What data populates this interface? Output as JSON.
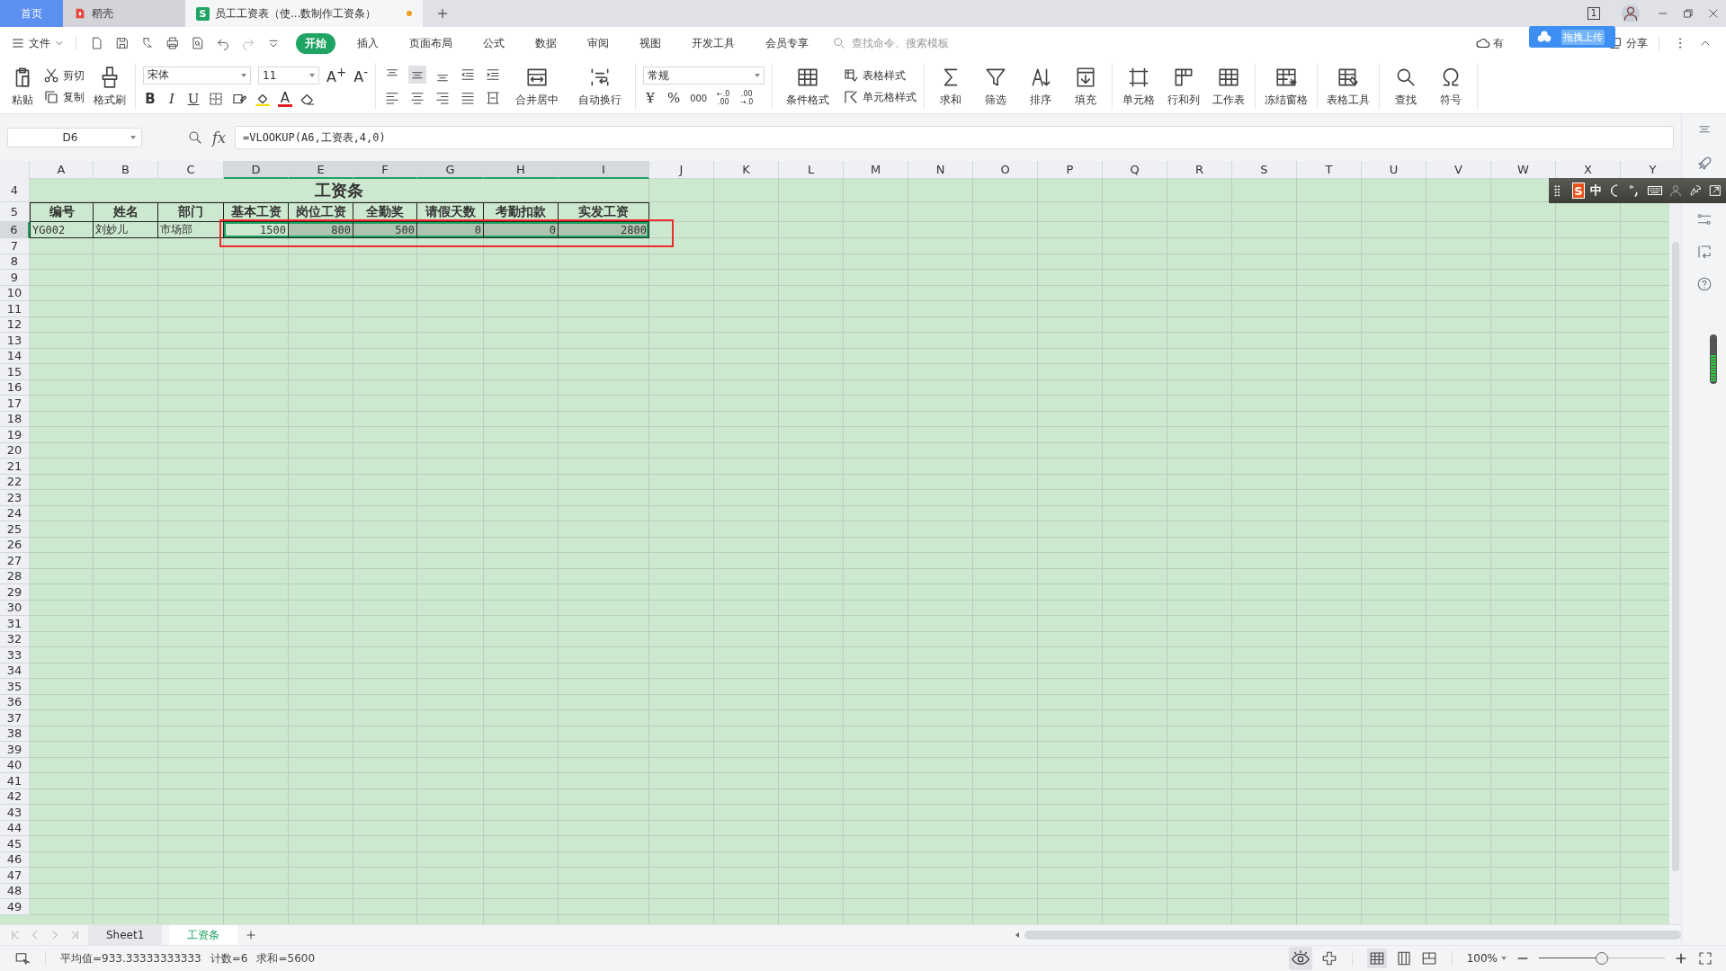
{
  "title_tabs": [
    {
      "label": "首页",
      "kind": "home",
      "selected": false
    },
    {
      "label": "稻壳",
      "kind": "docer",
      "selected": false
    },
    {
      "label": "员工工资表（使...数制作工资条）",
      "kind": "sheet",
      "selected": true,
      "modified": true,
      "logo": "S"
    }
  ],
  "window_badge": "1",
  "menu": {
    "file": "文件",
    "tabs": [
      {
        "label": "开始",
        "selected": true
      },
      {
        "label": "插入",
        "selected": false
      },
      {
        "label": "页面布局",
        "selected": false
      },
      {
        "label": "公式",
        "selected": false
      },
      {
        "label": "数据",
        "selected": false
      },
      {
        "label": "审阅",
        "selected": false
      },
      {
        "label": "视图",
        "selected": false
      },
      {
        "label": "开发工具",
        "selected": false
      },
      {
        "label": "会员专享",
        "selected": false
      }
    ],
    "search_placeholder": "查找命令、搜索模板",
    "sync_text": "有",
    "upload_tip": "拖拽上传",
    "share": "分享"
  },
  "ribbon": {
    "paste": "粘贴",
    "cut": "剪切",
    "copy": "复制",
    "format_painter": "格式刷",
    "font_name": "宋体",
    "font_size": "11",
    "grow_font": "A$^{+}$",
    "shrink_font": "A$^{-}$",
    "bold": "B",
    "italic": "I",
    "underline": "U",
    "font_color": "A",
    "merge_center": "合并居中",
    "wrap_text": "自动换行",
    "number_format": "常规",
    "currency": "¥",
    "percent": "%",
    "thousands": "000",
    "increase_decimal": [
      "←.0",
      ".00"
    ],
    "decrease_decimal": [
      ".00",
      "→.0"
    ],
    "conditional_format": "条件格式",
    "table_style": "表格样式",
    "cell_style": "单元格样式",
    "tools": [
      {
        "label": "求和"
      },
      {
        "label": "筛选"
      },
      {
        "label": "排序"
      },
      {
        "label": "填充"
      },
      {
        "label": "单元格"
      },
      {
        "label": "行和列"
      },
      {
        "label": "工作表"
      },
      {
        "label": "冻结窗格"
      },
      {
        "label": "表格工具"
      },
      {
        "label": "查找"
      },
      {
        "label": "符号"
      }
    ]
  },
  "formula_bar": {
    "cell_ref": "D6",
    "fx": "fx",
    "formula": "=VLOOKUP(A6,工资表,4,0)"
  },
  "columns": [
    {
      "label": "A",
      "selected": false
    },
    {
      "label": "B",
      "selected": false
    },
    {
      "label": "C",
      "selected": false
    },
    {
      "label": "D",
      "selected": true
    },
    {
      "label": "E",
      "selected": true
    },
    {
      "label": "F",
      "selected": true
    },
    {
      "label": "G",
      "selected": true
    },
    {
      "label": "H",
      "selected": true
    },
    {
      "label": "I",
      "selected": true
    },
    {
      "label": "J",
      "selected": false
    },
    {
      "label": "K",
      "selected": false
    },
    {
      "label": "L",
      "selected": false
    },
    {
      "label": "M",
      "selected": false
    },
    {
      "label": "N",
      "selected": false
    },
    {
      "label": "O",
      "selected": false
    },
    {
      "label": "P",
      "selected": false
    },
    {
      "label": "Q",
      "selected": false
    },
    {
      "label": "R",
      "selected": false
    },
    {
      "label": "S",
      "selected": false
    },
    {
      "label": "T",
      "selected": false
    },
    {
      "label": "U",
      "selected": false
    },
    {
      "label": "V",
      "selected": false
    },
    {
      "label": "W",
      "selected": false
    },
    {
      "label": "X",
      "selected": false
    },
    {
      "label": "Y",
      "selected": false
    }
  ],
  "rows": [
    {
      "number": "4",
      "kind": "title",
      "selected": false,
      "cells": [
        {
          "text": "工资条"
        }
      ]
    },
    {
      "number": "5",
      "kind": "header",
      "selected": false,
      "cells": [
        {
          "text": "编号"
        },
        {
          "text": "姓名"
        },
        {
          "text": "部门"
        },
        {
          "text": "基本工资"
        },
        {
          "text": "岗位工资"
        },
        {
          "text": "全勤奖"
        },
        {
          "text": "请假天数"
        },
        {
          "text": "考勤扣款"
        },
        {
          "text": "实发工资"
        }
      ]
    },
    {
      "number": "6",
      "kind": "data",
      "selected": true,
      "cells": [
        {
          "text": "YG002",
          "kind": "text",
          "selected": false
        },
        {
          "text": "刘妙儿",
          "kind": "text",
          "selected": false
        },
        {
          "text": "市场部",
          "kind": "text",
          "selected": false
        },
        {
          "text": "1500",
          "kind": "number",
          "selected": true,
          "active": true
        },
        {
          "text": "800",
          "kind": "number",
          "selected": true
        },
        {
          "text": "500",
          "kind": "number",
          "selected": true
        },
        {
          "text": "0",
          "kind": "number",
          "selected": true
        },
        {
          "text": "0",
          "kind": "number",
          "selected": true
        },
        {
          "text": "2800",
          "kind": "number",
          "selected": true
        }
      ]
    },
    {
      "number": "7",
      "kind": "empty",
      "selected": false
    },
    {
      "number": "8",
      "kind": "empty",
      "selected": false
    },
    {
      "number": "9",
      "kind": "empty",
      "selected": false
    },
    {
      "number": "10",
      "kind": "empty",
      "selected": false
    },
    {
      "number": "11",
      "kind": "empty",
      "selected": false
    },
    {
      "number": "12",
      "kind": "empty",
      "selected": false
    },
    {
      "number": "13",
      "kind": "empty",
      "selected": false
    },
    {
      "number": "14",
      "kind": "empty",
      "selected": false
    },
    {
      "number": "15",
      "kind": "empty",
      "selected": false
    },
    {
      "number": "16",
      "kind": "empty",
      "selected": false
    },
    {
      "number": "17",
      "kind": "empty",
      "selected": false
    },
    {
      "number": "18",
      "kind": "empty",
      "selected": false
    },
    {
      "number": "19",
      "kind": "empty",
      "selected": false
    },
    {
      "number": "20",
      "kind": "empty",
      "selected": false
    },
    {
      "number": "21",
      "kind": "empty",
      "selected": false
    },
    {
      "number": "22",
      "kind": "empty",
      "selected": false
    },
    {
      "number": "23",
      "kind": "empty",
      "selected": false
    },
    {
      "number": "24",
      "kind": "empty",
      "selected": false
    },
    {
      "number": "25",
      "kind": "empty",
      "selected": false
    },
    {
      "number": "26",
      "kind": "empty",
      "selected": false
    },
    {
      "number": "27",
      "kind": "empty",
      "selected": false
    },
    {
      "number": "28",
      "kind": "empty",
      "selected": false
    },
    {
      "number": "29",
      "kind": "empty",
      "selected": false
    },
    {
      "number": "30",
      "kind": "empty",
      "selected": false
    },
    {
      "number": "31",
      "kind": "empty",
      "selected": false
    },
    {
      "number": "32",
      "kind": "empty",
      "selected": false
    },
    {
      "number": "33",
      "kind": "empty",
      "selected": false
    },
    {
      "number": "34",
      "kind": "empty",
      "selected": false
    },
    {
      "number": "35",
      "kind": "empty",
      "selected": false
    },
    {
      "number": "36",
      "kind": "empty",
      "selected": false
    },
    {
      "number": "37",
      "kind": "empty",
      "selected": false
    },
    {
      "number": "38",
      "kind": "empty",
      "selected": false
    },
    {
      "number": "39",
      "kind": "empty",
      "selected": false
    },
    {
      "number": "40",
      "kind": "empty",
      "selected": false
    },
    {
      "number": "41",
      "kind": "empty",
      "selected": false
    },
    {
      "number": "42",
      "kind": "empty",
      "selected": false
    },
    {
      "number": "43",
      "kind": "empty",
      "selected": false
    },
    {
      "number": "44",
      "kind": "empty",
      "selected": false
    },
    {
      "number": "45",
      "kind": "empty",
      "selected": false
    },
    {
      "number": "46",
      "kind": "empty",
      "selected": false
    },
    {
      "number": "47",
      "kind": "empty",
      "selected": false
    },
    {
      "number": "48",
      "kind": "empty",
      "selected": false
    },
    {
      "number": "49",
      "kind": "empty",
      "selected": false
    }
  ],
  "sheet_tabs": [
    {
      "label": "Sheet1",
      "selected": false
    },
    {
      "label": "工资条",
      "selected": true
    }
  ],
  "ime_bar": {
    "logo": "S",
    "mode": "中"
  },
  "status_bar": {
    "average": "平均值=933.33333333333",
    "count": "计数=6",
    "sum": "求和=5600",
    "zoom": "100%",
    "zoom_slider": {
      "level": 0.5
    }
  }
}
